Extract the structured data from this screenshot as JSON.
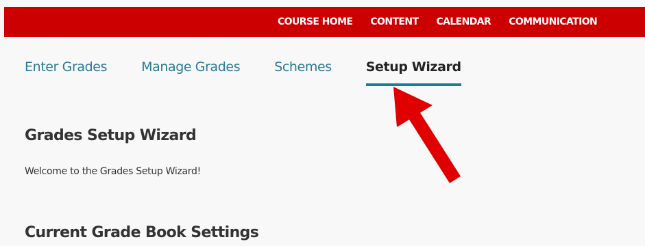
{
  "top_nav": {
    "items": [
      {
        "label": "COURSE HOME"
      },
      {
        "label": "CONTENT"
      },
      {
        "label": "CALENDAR"
      },
      {
        "label": "COMMUNICATION"
      }
    ]
  },
  "grade_tabs": {
    "items": [
      {
        "label": "Enter Grades"
      },
      {
        "label": "Manage Grades"
      },
      {
        "label": "Schemes"
      },
      {
        "label": "Setup Wizard"
      }
    ],
    "active": "Setup Wizard"
  },
  "main": {
    "title": "Grades Setup Wizard",
    "welcome_text": "Welcome to the Grades Setup Wizard!",
    "section_title": "Current Grade Book Settings"
  },
  "colors": {
    "topbar": "#cc0000",
    "tab_link": "#2a7a94",
    "active_underline": "#167f93",
    "annotation_arrow": "#e00000"
  }
}
